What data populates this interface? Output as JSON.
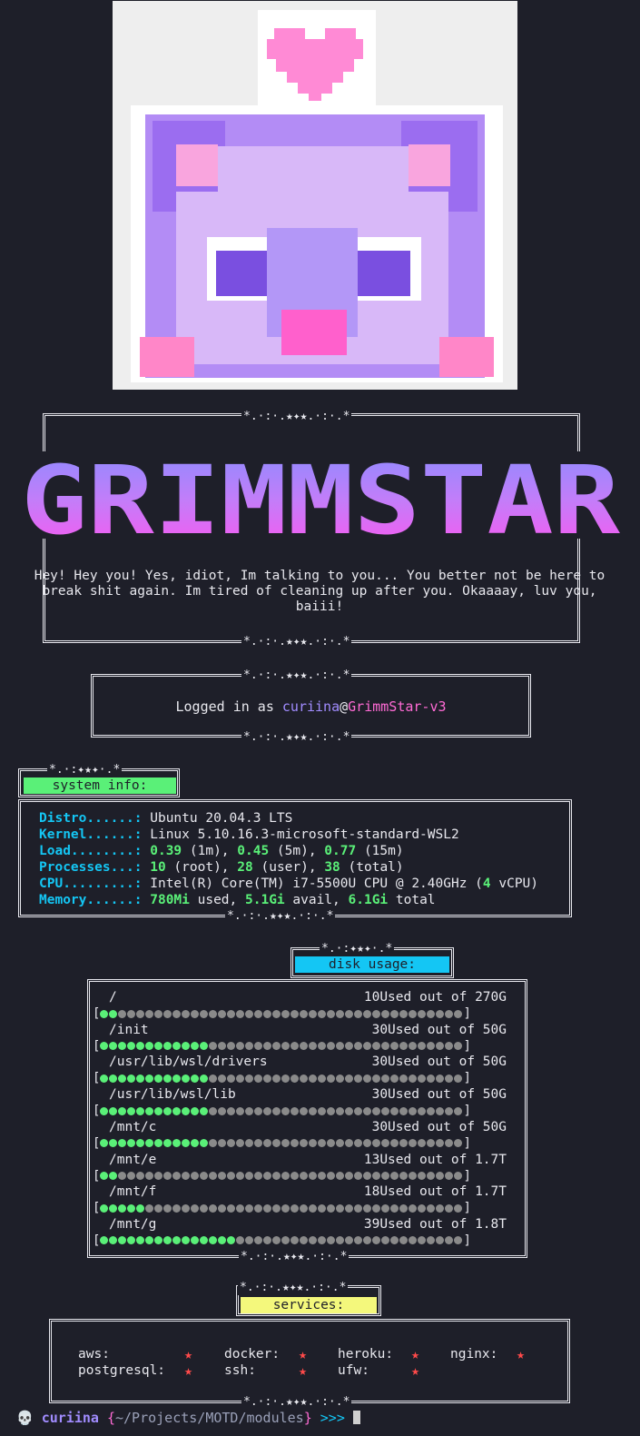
{
  "ornament": "*.·:·.★✦★.·:·.*",
  "ornament_short": "*.·:✦★✦·.*",
  "banner": "GRIMMSTAR",
  "greeting": "Hey! Hey you! Yes, idiot, Im talking to you... You better not be here to break shit again. Im tired of cleaning up after you. Okaaaay, luv you, baiii!",
  "login": {
    "prefix": "Logged in as ",
    "user": "curiina",
    "at": "@",
    "host": "GrimmStar-v3"
  },
  "sysinfo": {
    "header": "system info:",
    "distro_label": "Distro......:",
    "distro": "Ubuntu 20.04.3 LTS",
    "kernel_label": "Kernel......:",
    "kernel": "Linux 5.10.16.3-microsoft-standard-WSL2",
    "load_label": "Load........:",
    "load_1": "0.39",
    "load_1_unit": " (1m), ",
    "load_5": "0.45",
    "load_5_unit": " (5m), ",
    "load_15": "0.77",
    "load_15_unit": " (15m)",
    "proc_label": "Processes...:",
    "proc_root": "10",
    "proc_root_unit": " (root), ",
    "proc_user": "28",
    "proc_user_unit": " (user), ",
    "proc_total": "38",
    "proc_total_unit": " (total)",
    "cpu_label": "CPU.........:",
    "cpu_a": "Intel(R) Core(TM) i7-5500U CPU @ 2.40GHz (",
    "cpu_n": "4",
    "cpu_b": " vCPU)",
    "mem_label": "Memory......:",
    "mem_used": "780Mi",
    "mem_used_unit": " used, ",
    "mem_avail": "5.1Gi",
    "mem_avail_unit": " avail, ",
    "mem_total": "6.1Gi",
    "mem_total_unit": " total"
  },
  "disk": {
    "header": "disk usage:",
    "mounts": [
      {
        "path": "/",
        "usage": "10Used out of 270G",
        "fill": 0.04
      },
      {
        "path": "/init",
        "usage": "30Used out of 50G",
        "fill": 0.3
      },
      {
        "path": "/usr/lib/wsl/drivers",
        "usage": "30Used out of 50G",
        "fill": 0.3
      },
      {
        "path": "/usr/lib/wsl/lib",
        "usage": "30Used out of 50G",
        "fill": 0.3
      },
      {
        "path": "/mnt/c",
        "usage": "30Used out of 50G",
        "fill": 0.3
      },
      {
        "path": "/mnt/e",
        "usage": "13Used out of 1.7T",
        "fill": 0.06
      },
      {
        "path": "/mnt/f",
        "usage": "18Used out of 1.7T",
        "fill": 0.12
      },
      {
        "path": "/mnt/g",
        "usage": "39Used out of 1.8T",
        "fill": 0.38
      }
    ]
  },
  "services": {
    "header": "services:",
    "items": [
      {
        "name": "aws:",
        "status": "★"
      },
      {
        "name": "docker:",
        "status": "★"
      },
      {
        "name": "heroku:",
        "status": "★"
      },
      {
        "name": "nginx:",
        "status": "★"
      },
      {
        "name": "postgresql:",
        "status": "★"
      },
      {
        "name": "ssh:",
        "status": "★"
      },
      {
        "name": "ufw:",
        "status": "★"
      }
    ]
  },
  "prompt": {
    "skull": "💀",
    "user": "curiina",
    "path_open": " {",
    "path": "~/Projects/MOTD/modules",
    "path_close": "}",
    "arrows": " >>> "
  },
  "colors": {
    "bg": "#1e1f29",
    "cyan": "#14c6f4",
    "green": "#5af078",
    "purple": "#a18cff",
    "pink": "#ff6bd5",
    "red": "#ff4a4a",
    "yellow": "#f4f87c"
  }
}
